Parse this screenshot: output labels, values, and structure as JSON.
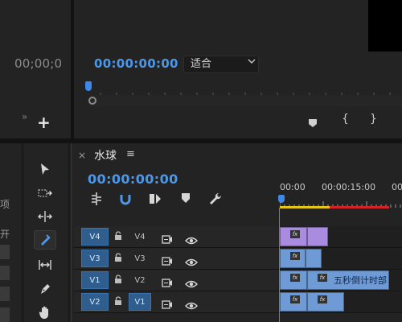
{
  "source_monitor": {
    "timecode": "00;00;0",
    "add_label": "+",
    "more_label": "»"
  },
  "program_monitor": {
    "timecode": "00:00:00:00",
    "fit_value": "适合",
    "brace_open": "{",
    "brace_close": "}"
  },
  "left_panel": {
    "fragment_1": "项",
    "fragment_2": "开"
  },
  "timeline": {
    "close": "×",
    "title": "水球",
    "menu": "≡",
    "timecode": "00:00:00:00",
    "ruler_labels": [
      "00:00",
      "00:00:15:00",
      "00"
    ],
    "tracks": [
      {
        "source": "V4",
        "name": "V4",
        "targeted": false
      },
      {
        "source": "V3",
        "name": "V3",
        "targeted": false
      },
      {
        "source": "V1",
        "name": "V2",
        "targeted": false
      },
      {
        "source": "V2",
        "name": "V1",
        "targeted": true
      }
    ],
    "clip_label": "五秒倒计时部",
    "fx": "fx"
  },
  "colors": {
    "accent_blue": "#4d97e8",
    "clip_purple": "#a98be0",
    "clip_blue": "#6e9bd6",
    "work_area_yellow": "#e6c619",
    "render_red": "#d62222"
  }
}
